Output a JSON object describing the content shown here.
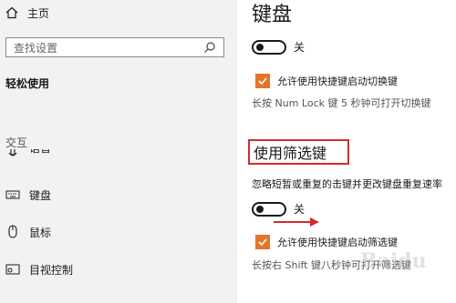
{
  "sidebar": {
    "home_label": "主页",
    "search_placeholder": "查找设置",
    "section_title": "轻松使用",
    "group_label": "交互",
    "items": [
      {
        "label": "语音",
        "icon": "microphone-icon"
      },
      {
        "label": "键盘",
        "icon": "keyboard-icon"
      },
      {
        "label": "鼠标",
        "icon": "mouse-icon"
      },
      {
        "label": "目视控制",
        "icon": "eye-control-icon"
      }
    ]
  },
  "main": {
    "title": "键盘",
    "toggle1_state": "关",
    "checkbox1_label": "允许使用快捷键启动切换键",
    "hint1": "长按 Num Lock 键 5 秒钟可打开切换键",
    "filter_keys_heading": "使用筛选键",
    "filter_desc": "忽略短暂或重复的击键并更改键盘重复速率",
    "toggle2_state": "关",
    "checkbox2_label": "允许使用快捷键启动筛选键",
    "hint2": "长按右 Shift 键八秒钟可打开筛选键"
  },
  "colors": {
    "accent": "#e3752b",
    "highlight": "#d52b2b",
    "sidebar_bg": "#f2f2f2"
  },
  "watermark": "Baidu"
}
